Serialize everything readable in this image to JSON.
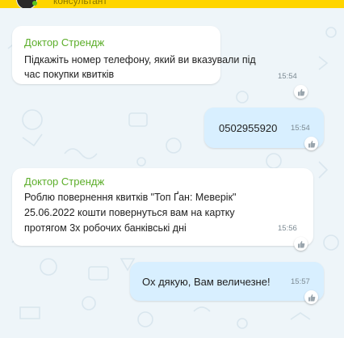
{
  "header": {
    "status": "консультант"
  },
  "messages": [
    {
      "direction": "in",
      "sender": "Доктор Стрендж",
      "lines": [
        "Підкажіть номер телефону, який ви вказували під",
        "час покупки квитків"
      ],
      "time": "15:54"
    },
    {
      "direction": "out",
      "lines": [
        "0502955920"
      ],
      "time": "15:54"
    },
    {
      "direction": "in",
      "sender": "Доктор Стрендж",
      "lines": [
        "Роблю повернення квитків \"Топ Ґан: Меверік\"",
        "25.06.2022 кошти повернуться вам на картку",
        "протягом 3х робочих банківські дні"
      ],
      "time": "15:56"
    },
    {
      "direction": "out",
      "lines": [
        "Ох дякую, Вам величезне!"
      ],
      "time": "15:57"
    }
  ],
  "colors": {
    "header": "#ffd500",
    "sender": "#5cae2a",
    "incoming_bubble": "#ffffff",
    "outgoing_bubble": "#d8efff",
    "background": "#eef5f9"
  }
}
